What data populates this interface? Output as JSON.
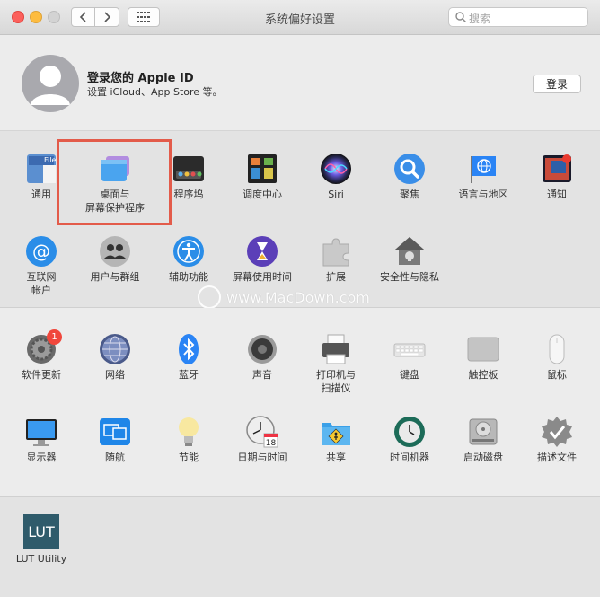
{
  "window": {
    "title": "系统偏好设置"
  },
  "search": {
    "placeholder": "搜索"
  },
  "apple_id": {
    "title": "登录您的 Apple ID",
    "subtitle": "设置 iCloud、App Store 等。",
    "login_label": "登录"
  },
  "section1": [
    {
      "label": "通用",
      "icon": "general-icon"
    },
    {
      "label": "桌面与\n屏幕保护程序",
      "icon": "desktop-screensaver-icon"
    },
    {
      "label": "程序坞",
      "icon": "dock-icon"
    },
    {
      "label": "调度中心",
      "icon": "mission-control-icon"
    },
    {
      "label": "Siri",
      "icon": "siri-icon"
    },
    {
      "label": "聚焦",
      "icon": "spotlight-icon"
    },
    {
      "label": "语言与地区",
      "icon": "language-region-icon"
    },
    {
      "label": "通知",
      "icon": "notifications-icon"
    },
    {
      "label": "互联网\n帐户",
      "icon": "internet-accounts-icon"
    },
    {
      "label": "用户与群组",
      "icon": "users-groups-icon"
    },
    {
      "label": "辅助功能",
      "icon": "accessibility-icon"
    },
    {
      "label": "屏幕使用时间",
      "icon": "screen-time-icon"
    },
    {
      "label": "扩展",
      "icon": "extensions-icon"
    },
    {
      "label": "安全性与隐私",
      "icon": "security-privacy-icon"
    }
  ],
  "section2": [
    {
      "label": "软件更新",
      "icon": "software-update-icon",
      "badge": "1"
    },
    {
      "label": "网络",
      "icon": "network-icon"
    },
    {
      "label": "蓝牙",
      "icon": "bluetooth-icon"
    },
    {
      "label": "声音",
      "icon": "sound-icon"
    },
    {
      "label": "打印机与\n扫描仪",
      "icon": "printers-scanners-icon"
    },
    {
      "label": "键盘",
      "icon": "keyboard-icon"
    },
    {
      "label": "触控板",
      "icon": "trackpad-icon"
    },
    {
      "label": "鼠标",
      "icon": "mouse-icon"
    },
    {
      "label": "显示器",
      "icon": "displays-icon"
    },
    {
      "label": "随航",
      "icon": "sidecar-icon"
    },
    {
      "label": "节能",
      "icon": "energy-saver-icon"
    },
    {
      "label": "日期与时间",
      "icon": "date-time-icon",
      "date": "18"
    },
    {
      "label": "共享",
      "icon": "sharing-icon"
    },
    {
      "label": "时间机器",
      "icon": "time-machine-icon"
    },
    {
      "label": "启动磁盘",
      "icon": "startup-disk-icon"
    },
    {
      "label": "描述文件",
      "icon": "profiles-icon"
    }
  ],
  "section3": [
    {
      "label": "LUT Utility",
      "icon": "lut-utility-icon",
      "icon_text": "LUT"
    }
  ],
  "dock_icon_text": "File",
  "watermark": "www.MacDown.com",
  "colors": {
    "highlight": "#e35b4a",
    "badge": "#f0473c",
    "accent": "#2a84f5"
  }
}
